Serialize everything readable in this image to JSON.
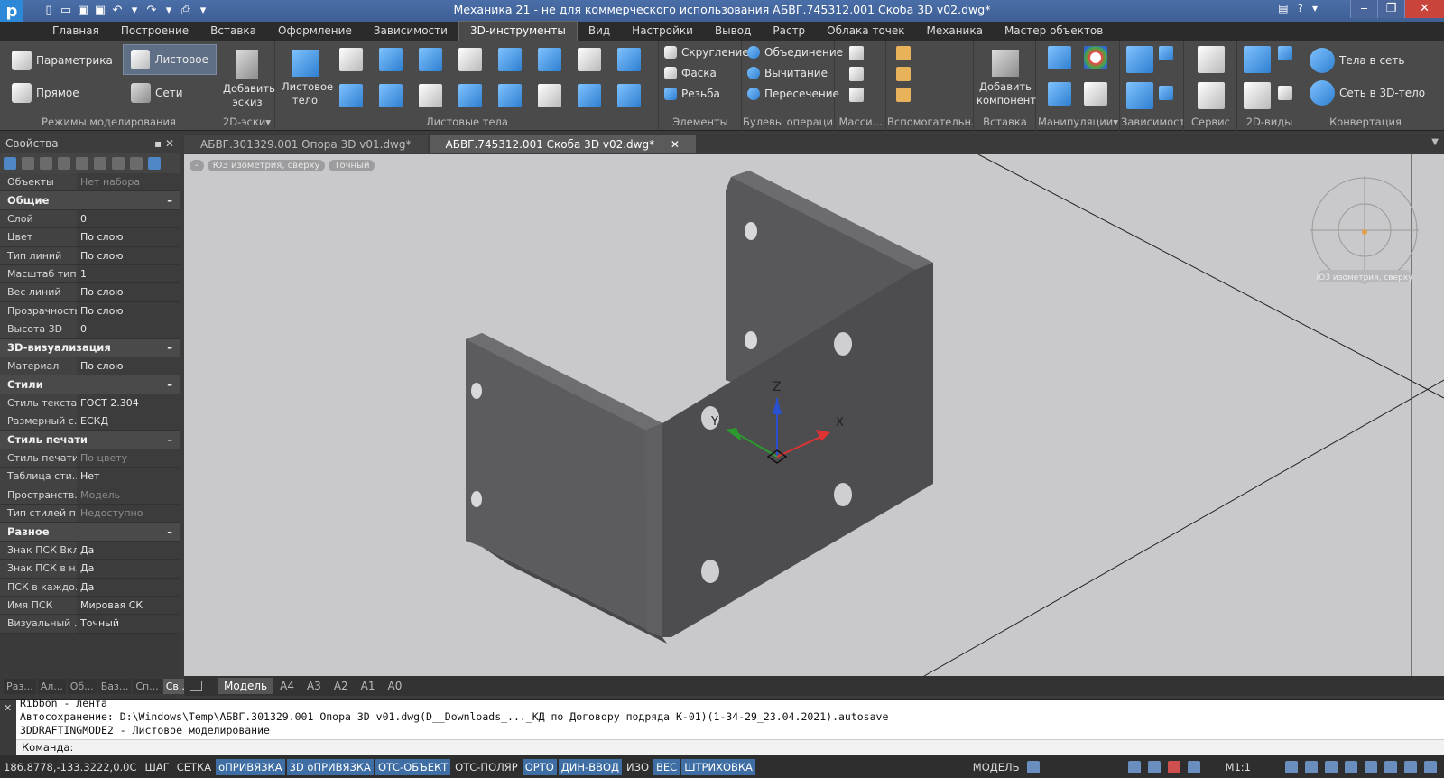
{
  "window": {
    "title": "Механика 21 - не для коммерческого использования АБВГ.745312.001 Скоба 3D v02.dwg*",
    "logo": "р",
    "controls": {
      "minimize": "‒",
      "maximize": "❐",
      "close": "✕"
    },
    "help": "?"
  },
  "menu": {
    "tabs": [
      "Главная",
      "Построение",
      "Вставка",
      "Оформление",
      "Зависимости",
      "3D-инструменты",
      "Вид",
      "Настройки",
      "Вывод",
      "Растр",
      "Облака точек",
      "Механика",
      "Мастер объектов"
    ],
    "active": "3D-инструменты"
  },
  "ribbon": {
    "modes": {
      "param": "Параметрика",
      "sheet": "Листовое",
      "direct": "Прямое",
      "mesh": "Сети",
      "label": "Режимы моделирования"
    },
    "sketch": {
      "add": "Добавить эскиз",
      "label": "2D-эски▾"
    },
    "sheetbody": {
      "btn": "Листовое тело",
      "label": "Листовые тела"
    },
    "elements": {
      "fillet": "Скругление",
      "chamfer": "Фаска",
      "thread": "Резьба",
      "label": "Элементы"
    },
    "boolean": {
      "union": "Объединение",
      "subtract": "Вычитание",
      "intersect": "Пересечение",
      "label": "Булевы операции"
    },
    "array": {
      "label": "Масси..."
    },
    "aux": {
      "label": "Вспомогательн..."
    },
    "insert": {
      "btn": "Добавить компонент",
      "label": "Вставка"
    },
    "manip": {
      "label": "Манипуляции▾"
    },
    "deps": {
      "label": "Зависимости"
    },
    "service": {
      "label": "Сервис"
    },
    "views2d": {
      "label": "2D-виды"
    },
    "convert": {
      "to_mesh": "Тела в сеть",
      "to_solid": "Сеть в 3D-тело",
      "label": "Конвертация"
    }
  },
  "properties": {
    "title": "Свойства",
    "objects_key": "Объекты",
    "objects_val": "Нет набора",
    "sections": [
      {
        "name": "Общие",
        "rows": [
          {
            "k": "Слой",
            "v": "0"
          },
          {
            "k": "Цвет",
            "v": "По слою"
          },
          {
            "k": "Тип линий",
            "v": "По слою"
          },
          {
            "k": "Масштаб тип...",
            "v": "1"
          },
          {
            "k": "Вес линий",
            "v": "По слою"
          },
          {
            "k": "Прозрачность",
            "v": "По слою"
          },
          {
            "k": "Высота 3D",
            "v": "0"
          }
        ]
      },
      {
        "name": "3D-визуализация",
        "rows": [
          {
            "k": "Материал",
            "v": "По слою"
          }
        ]
      },
      {
        "name": "Стили",
        "rows": [
          {
            "k": "Стиль текста",
            "v": "ГОСТ 2.304"
          },
          {
            "k": "Размерный с...",
            "v": "ЕСКД"
          }
        ]
      },
      {
        "name": "Стиль печати",
        "rows": [
          {
            "k": "Стиль печати",
            "v": "По цвету"
          },
          {
            "k": "Таблица сти...",
            "v": "Нет"
          },
          {
            "k": "Пространств...",
            "v": "Модель"
          },
          {
            "k": "Тип стилей п...",
            "v": "Недоступно"
          }
        ]
      },
      {
        "name": "Разное",
        "rows": [
          {
            "k": "Знак ПСК Вкл",
            "v": "Да"
          },
          {
            "k": "Знак ПСК в н...",
            "v": "Да"
          },
          {
            "k": "ПСК в каждо...",
            "v": "Да"
          },
          {
            "k": "Имя ПСК",
            "v": "Мировая СК"
          },
          {
            "k": "Визуальный ...",
            "v": "Точный"
          }
        ]
      }
    ],
    "bottom_tabs": [
      "Раз...",
      "Ал...",
      "Об...",
      "Баз...",
      "Сп...",
      "Св..."
    ]
  },
  "documents": {
    "tabs": [
      "АБВГ.301329.001 Опора 3D v01.dwg*",
      "АБВГ.745312.001 Скоба 3D v02.dwg*"
    ],
    "active_index": 1
  },
  "viewport": {
    "view_label": "ЮЗ изометрия, сверху",
    "style_label": "Точный",
    "minus": "-",
    "compass_label": "ЮЗ изометрия, сверху",
    "axes": {
      "x": "X",
      "y": "Y",
      "z": "Z"
    }
  },
  "layouts": {
    "model": "Модель",
    "sheets": [
      "А4",
      "А3",
      "А2",
      "А1",
      "А0"
    ]
  },
  "command": {
    "history": [
      "Ribbon - лента",
      "Автосохранение: D:\\Windows\\Temp\\АБВГ.301329.001 Опора 3D v01.dwg(D__Downloads_..._КД по Договору подряда К-01)(1-34-29_23.04.2021).autosave",
      "3DDRAFTINGMODE2 - Листовое моделирование"
    ],
    "prompt": "Команда:"
  },
  "status": {
    "coords": "186.8778,-133.3222,0.0С",
    "toggles": [
      {
        "label": "ШАГ",
        "on": false
      },
      {
        "label": "СЕТКА",
        "on": false
      },
      {
        "label": "оПРИВЯЗКА",
        "on": true
      },
      {
        "label": "3D оПРИВЯЗКА",
        "on": true
      },
      {
        "label": "ОТС-ОБЪЕКТ",
        "on": true
      },
      {
        "label": "ОТС-ПОЛЯР",
        "on": false
      },
      {
        "label": "ОРТО",
        "on": true
      },
      {
        "label": "ДИН-ВВОД",
        "on": true
      },
      {
        "label": "ИЗО",
        "on": false
      },
      {
        "label": "ВЕС",
        "on": true
      },
      {
        "label": "ШТРИХОВКА",
        "on": true
      }
    ],
    "space": "МОДЕЛЬ",
    "scale": "М1:1"
  },
  "colors": {
    "accent": "#3e6ea3",
    "viewport": "#c9c9cc",
    "part": "#4f4f52"
  }
}
